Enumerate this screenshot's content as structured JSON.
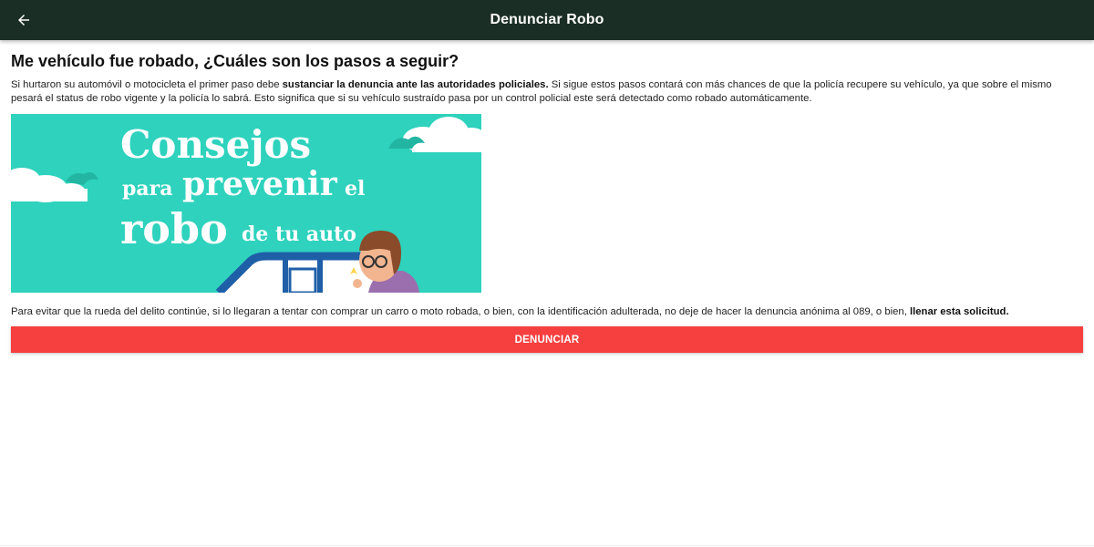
{
  "appbar": {
    "title": "Denunciar Robo",
    "back_icon": "arrow-left-icon",
    "background": "#1b2e25"
  },
  "main": {
    "heading": "Me vehículo fue robado, ¿Cuáles son los pasos a seguir?",
    "intro": {
      "part1": "Si hurtaron su automóvil o motocicleta el primer paso debe ",
      "bold": "sustanciar la denuncia ante las autoridades policiales.",
      "part2": " Si sigue estos pasos contará con más chances de que la policía recupere su vehículo, ya que sobre el mismo pesará el status de robo vigente y la policía lo sabrá. Esto significa que si su vehículo sustraído pasa por un control policial este será detectado como robado automáticamente."
    },
    "banner": {
      "line1": "Consejos",
      "line2a": "para",
      "line2b": "prevenir",
      "line2c": "el",
      "line3a": "robo",
      "line3b": "de tu auto",
      "background": "#2ed2bd"
    },
    "advice": {
      "part1": "Para evitar que la rueda del delito continúe, si lo llegaran a tentar con comprar un carro o moto robada, o bien, con la identificación adulterada, no deje de hacer la denuncia anónima al 089, o bien, ",
      "bold": "llenar esta solicitud."
    },
    "cta_label": "DENUNCIAR",
    "cta_color": "#f5403f"
  }
}
